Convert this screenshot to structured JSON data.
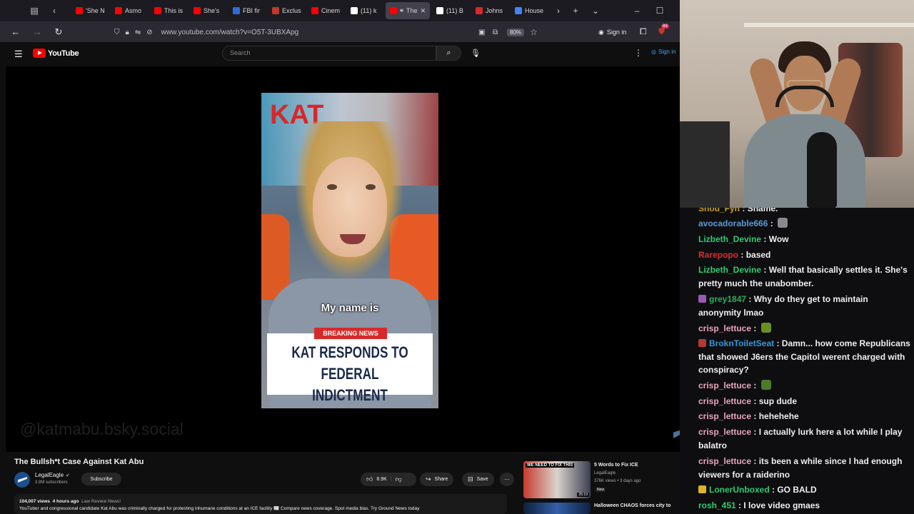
{
  "browser": {
    "tabs": [
      {
        "label": "'She N",
        "color": "#ff0000"
      },
      {
        "label": "Asmo",
        "color": "#ff0000"
      },
      {
        "label": "This is",
        "color": "#ff0000"
      },
      {
        "label": "She's",
        "color": "#ff0000"
      },
      {
        "label": "FBI fir",
        "color": "#2b6cd6"
      },
      {
        "label": "Exclus",
        "color": "#c0392b"
      },
      {
        "label": "Cinem",
        "color": "#ff0000"
      },
      {
        "label": "(11) k",
        "color": "#ffffff"
      },
      {
        "label": "The",
        "color": "#ff0000",
        "active": true
      },
      {
        "label": "(11) B",
        "color": "#ffffff"
      },
      {
        "label": "Johns",
        "color": "#d62a2a"
      },
      {
        "label": "House",
        "color": "#4285f4"
      }
    ],
    "url": "www.youtube.com/watch?v=O5T-3UBXApg",
    "zoom": "80%",
    "sign_in": "Sign in",
    "ext_badge": "89"
  },
  "youtube": {
    "logo": "YouTube",
    "search_placeholder": "Search",
    "sign_in": "Sign in"
  },
  "video": {
    "caption": "My name is",
    "breaking": "BREAKING NEWS",
    "headline_1": "KAT RESPONDS TO",
    "headline_2": "FEDERAL INDICTMENT",
    "poster_text": "KAT",
    "watermark": "@katmabu.bsky.social"
  },
  "details": {
    "title": "The Bullsh*t Case Against Kat Abu",
    "channel": "LegalEagle",
    "subscribers": "3.8M subscribers",
    "subscribe": "Subscribe",
    "likes": "8.9K",
    "share": "Share",
    "save": "Save",
    "views": "104,007 views",
    "age": "4 hours ago",
    "tag": "Law Review News!",
    "description": "YouTuber and congressional candidate Kat Abu was criminally charged for protesting inhumane conditions at an ICE facility 📰 Compare news coverage. Spot media bias. Try Ground News today"
  },
  "related": [
    {
      "title": "5 Words to Fix ICE",
      "channel": "LegalEagle",
      "meta": "376K views • 3 days ago",
      "badge": "New",
      "thumb_text": "WE NEED TO FIX THIS",
      "duration": "25:19"
    },
    {
      "title": "Halloween CHAOS forces city to",
      "channel": "",
      "meta": ""
    }
  ],
  "chat": [
    {
      "user": "Shou_Fyn",
      "color": "#c9a227",
      "text": "Shame."
    },
    {
      "user": "avocadorable666",
      "color": "#5b9bd5",
      "text": "",
      "emote": "#8a8a8a"
    },
    {
      "user": "Lizbeth_Devine",
      "color": "#2ecc71",
      "text": "Wow"
    },
    {
      "user": "Rarepopo",
      "color": "#d63031",
      "text": "based"
    },
    {
      "user": "Lizbeth_Devine",
      "color": "#2ecc71",
      "text": "Well that basically settles it. She's pretty much the unabomber."
    },
    {
      "user": "grey1847",
      "color": "#27ae60",
      "text": "Why do they get to maintain anonymity lmao",
      "badge": "#9b59b6"
    },
    {
      "user": "crisp_lettuce",
      "color": "#e8a4b8",
      "text": "",
      "emote": "#6b8e23"
    },
    {
      "user": "BroknToiletSeat",
      "color": "#3498db",
      "text": "Damn... how come Republicans that showed J6ers the Capitol werent charged with conspiracy?",
      "badge": "#b33939"
    },
    {
      "user": "crisp_lettuce",
      "color": "#e8a4b8",
      "text": "",
      "emote": "#4a7a2a"
    },
    {
      "user": "crisp_lettuce",
      "color": "#e8a4b8",
      "text": "sup dude"
    },
    {
      "user": "crisp_lettuce",
      "color": "#e8a4b8",
      "text": "hehehehe"
    },
    {
      "user": "crisp_lettuce",
      "color": "#e8a4b8",
      "text": "I actually lurk here a lot while I play balatro"
    },
    {
      "user": "crisp_lettuce",
      "color": "#e8a4b8",
      "text": "its been a while since I had enough viewers for a raiderino"
    },
    {
      "user": "LonerUnboxed",
      "color": "#2ecc71",
      "text": "GO BALD",
      "badge": "#e1b12c"
    },
    {
      "user": "rosh_451",
      "color": "#2ecc71",
      "text": "I love video gmaes"
    }
  ]
}
